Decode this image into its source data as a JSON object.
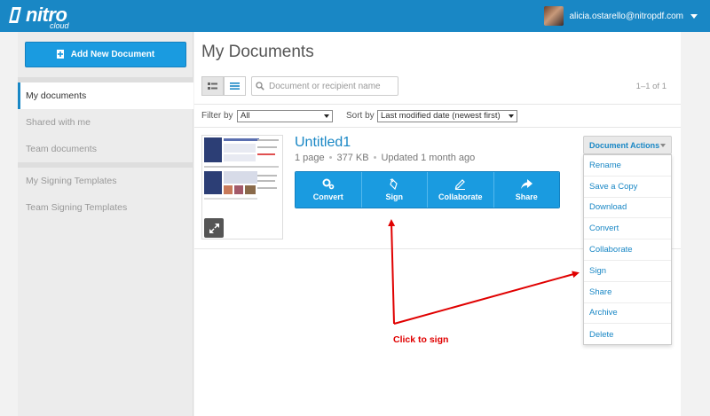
{
  "app": {
    "logo_text": "nitro",
    "logo_sub": "cloud",
    "user_email": "alicia.ostarello@nitropdf.com"
  },
  "sidebar": {
    "add_button": "Add New Document",
    "items": [
      {
        "label": "My documents",
        "active": true
      },
      {
        "label": "Shared with me"
      },
      {
        "label": "Team documents"
      },
      {
        "label": "My Signing Templates"
      },
      {
        "label": "Team Signing Templates"
      }
    ]
  },
  "main": {
    "title": "My Documents",
    "search_placeholder": "Document or recipient name",
    "pager": "1–1 of 1",
    "filter_label": "Filter by",
    "filter_value": "All",
    "sort_label": "Sort by",
    "sort_value": "Last modified date (newest first)"
  },
  "document": {
    "title": "Untitled1",
    "pages": "1 page",
    "size": "377 KB",
    "updated": "Updated 1 month ago",
    "actions": [
      "Convert",
      "Sign",
      "Collaborate",
      "Share"
    ]
  },
  "doc_actions": {
    "button": "Document Actions",
    "items": [
      "Rename",
      "Save a Copy",
      "Download",
      "Convert",
      "Collaborate",
      "Sign",
      "Share",
      "Archive",
      "Delete"
    ]
  },
  "annotation": {
    "text": "Click to sign",
    "color": "#e00000"
  },
  "colors": {
    "brand_blue": "#1987c5",
    "button_blue": "#1a9be0"
  }
}
